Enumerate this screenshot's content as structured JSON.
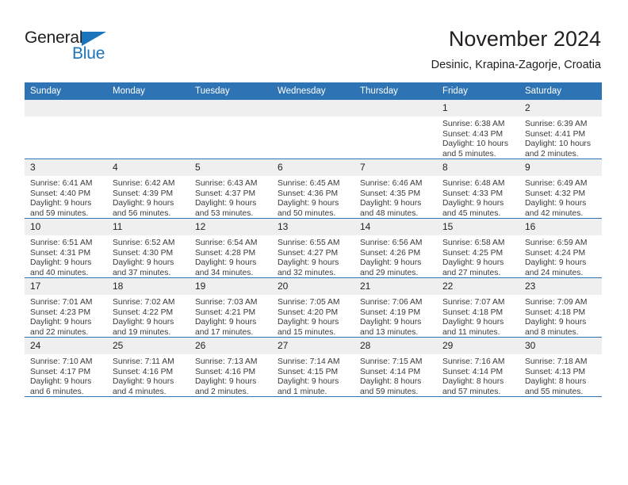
{
  "brand": {
    "name_part1": "General",
    "name_part2": "Blue",
    "triangle_color": "#1b75bc"
  },
  "header": {
    "title": "November 2024",
    "subtitle": "Desinic, Krapina-Zagorje, Croatia",
    "accent_color": "#2e74b5"
  },
  "weekday_headers": [
    "Sunday",
    "Monday",
    "Tuesday",
    "Wednesday",
    "Thursday",
    "Friday",
    "Saturday"
  ],
  "weeks": [
    [
      {
        "day": "",
        "blank": true,
        "sunrise": "",
        "sunset": "",
        "daylight1": "",
        "daylight2": ""
      },
      {
        "day": "",
        "blank": true,
        "sunrise": "",
        "sunset": "",
        "daylight1": "",
        "daylight2": ""
      },
      {
        "day": "",
        "blank": true,
        "sunrise": "",
        "sunset": "",
        "daylight1": "",
        "daylight2": ""
      },
      {
        "day": "",
        "blank": true,
        "sunrise": "",
        "sunset": "",
        "daylight1": "",
        "daylight2": ""
      },
      {
        "day": "",
        "blank": true,
        "sunrise": "",
        "sunset": "",
        "daylight1": "",
        "daylight2": ""
      },
      {
        "day": "1",
        "blank": false,
        "sunrise": "Sunrise: 6:38 AM",
        "sunset": "Sunset: 4:43 PM",
        "daylight1": "Daylight: 10 hours",
        "daylight2": "and 5 minutes."
      },
      {
        "day": "2",
        "blank": false,
        "sunrise": "Sunrise: 6:39 AM",
        "sunset": "Sunset: 4:41 PM",
        "daylight1": "Daylight: 10 hours",
        "daylight2": "and 2 minutes."
      }
    ],
    [
      {
        "day": "3",
        "blank": false,
        "sunrise": "Sunrise: 6:41 AM",
        "sunset": "Sunset: 4:40 PM",
        "daylight1": "Daylight: 9 hours",
        "daylight2": "and 59 minutes."
      },
      {
        "day": "4",
        "blank": false,
        "sunrise": "Sunrise: 6:42 AM",
        "sunset": "Sunset: 4:39 PM",
        "daylight1": "Daylight: 9 hours",
        "daylight2": "and 56 minutes."
      },
      {
        "day": "5",
        "blank": false,
        "sunrise": "Sunrise: 6:43 AM",
        "sunset": "Sunset: 4:37 PM",
        "daylight1": "Daylight: 9 hours",
        "daylight2": "and 53 minutes."
      },
      {
        "day": "6",
        "blank": false,
        "sunrise": "Sunrise: 6:45 AM",
        "sunset": "Sunset: 4:36 PM",
        "daylight1": "Daylight: 9 hours",
        "daylight2": "and 50 minutes."
      },
      {
        "day": "7",
        "blank": false,
        "sunrise": "Sunrise: 6:46 AM",
        "sunset": "Sunset: 4:35 PM",
        "daylight1": "Daylight: 9 hours",
        "daylight2": "and 48 minutes."
      },
      {
        "day": "8",
        "blank": false,
        "sunrise": "Sunrise: 6:48 AM",
        "sunset": "Sunset: 4:33 PM",
        "daylight1": "Daylight: 9 hours",
        "daylight2": "and 45 minutes."
      },
      {
        "day": "9",
        "blank": false,
        "sunrise": "Sunrise: 6:49 AM",
        "sunset": "Sunset: 4:32 PM",
        "daylight1": "Daylight: 9 hours",
        "daylight2": "and 42 minutes."
      }
    ],
    [
      {
        "day": "10",
        "blank": false,
        "sunrise": "Sunrise: 6:51 AM",
        "sunset": "Sunset: 4:31 PM",
        "daylight1": "Daylight: 9 hours",
        "daylight2": "and 40 minutes."
      },
      {
        "day": "11",
        "blank": false,
        "sunrise": "Sunrise: 6:52 AM",
        "sunset": "Sunset: 4:30 PM",
        "daylight1": "Daylight: 9 hours",
        "daylight2": "and 37 minutes."
      },
      {
        "day": "12",
        "blank": false,
        "sunrise": "Sunrise: 6:54 AM",
        "sunset": "Sunset: 4:28 PM",
        "daylight1": "Daylight: 9 hours",
        "daylight2": "and 34 minutes."
      },
      {
        "day": "13",
        "blank": false,
        "sunrise": "Sunrise: 6:55 AM",
        "sunset": "Sunset: 4:27 PM",
        "daylight1": "Daylight: 9 hours",
        "daylight2": "and 32 minutes."
      },
      {
        "day": "14",
        "blank": false,
        "sunrise": "Sunrise: 6:56 AM",
        "sunset": "Sunset: 4:26 PM",
        "daylight1": "Daylight: 9 hours",
        "daylight2": "and 29 minutes."
      },
      {
        "day": "15",
        "blank": false,
        "sunrise": "Sunrise: 6:58 AM",
        "sunset": "Sunset: 4:25 PM",
        "daylight1": "Daylight: 9 hours",
        "daylight2": "and 27 minutes."
      },
      {
        "day": "16",
        "blank": false,
        "sunrise": "Sunrise: 6:59 AM",
        "sunset": "Sunset: 4:24 PM",
        "daylight1": "Daylight: 9 hours",
        "daylight2": "and 24 minutes."
      }
    ],
    [
      {
        "day": "17",
        "blank": false,
        "sunrise": "Sunrise: 7:01 AM",
        "sunset": "Sunset: 4:23 PM",
        "daylight1": "Daylight: 9 hours",
        "daylight2": "and 22 minutes."
      },
      {
        "day": "18",
        "blank": false,
        "sunrise": "Sunrise: 7:02 AM",
        "sunset": "Sunset: 4:22 PM",
        "daylight1": "Daylight: 9 hours",
        "daylight2": "and 19 minutes."
      },
      {
        "day": "19",
        "blank": false,
        "sunrise": "Sunrise: 7:03 AM",
        "sunset": "Sunset: 4:21 PM",
        "daylight1": "Daylight: 9 hours",
        "daylight2": "and 17 minutes."
      },
      {
        "day": "20",
        "blank": false,
        "sunrise": "Sunrise: 7:05 AM",
        "sunset": "Sunset: 4:20 PM",
        "daylight1": "Daylight: 9 hours",
        "daylight2": "and 15 minutes."
      },
      {
        "day": "21",
        "blank": false,
        "sunrise": "Sunrise: 7:06 AM",
        "sunset": "Sunset: 4:19 PM",
        "daylight1": "Daylight: 9 hours",
        "daylight2": "and 13 minutes."
      },
      {
        "day": "22",
        "blank": false,
        "sunrise": "Sunrise: 7:07 AM",
        "sunset": "Sunset: 4:18 PM",
        "daylight1": "Daylight: 9 hours",
        "daylight2": "and 11 minutes."
      },
      {
        "day": "23",
        "blank": false,
        "sunrise": "Sunrise: 7:09 AM",
        "sunset": "Sunset: 4:18 PM",
        "daylight1": "Daylight: 9 hours",
        "daylight2": "and 8 minutes."
      }
    ],
    [
      {
        "day": "24",
        "blank": false,
        "sunrise": "Sunrise: 7:10 AM",
        "sunset": "Sunset: 4:17 PM",
        "daylight1": "Daylight: 9 hours",
        "daylight2": "and 6 minutes."
      },
      {
        "day": "25",
        "blank": false,
        "sunrise": "Sunrise: 7:11 AM",
        "sunset": "Sunset: 4:16 PM",
        "daylight1": "Daylight: 9 hours",
        "daylight2": "and 4 minutes."
      },
      {
        "day": "26",
        "blank": false,
        "sunrise": "Sunrise: 7:13 AM",
        "sunset": "Sunset: 4:16 PM",
        "daylight1": "Daylight: 9 hours",
        "daylight2": "and 2 minutes."
      },
      {
        "day": "27",
        "blank": false,
        "sunrise": "Sunrise: 7:14 AM",
        "sunset": "Sunset: 4:15 PM",
        "daylight1": "Daylight: 9 hours",
        "daylight2": "and 1 minute."
      },
      {
        "day": "28",
        "blank": false,
        "sunrise": "Sunrise: 7:15 AM",
        "sunset": "Sunset: 4:14 PM",
        "daylight1": "Daylight: 8 hours",
        "daylight2": "and 59 minutes."
      },
      {
        "day": "29",
        "blank": false,
        "sunrise": "Sunrise: 7:16 AM",
        "sunset": "Sunset: 4:14 PM",
        "daylight1": "Daylight: 8 hours",
        "daylight2": "and 57 minutes."
      },
      {
        "day": "30",
        "blank": false,
        "sunrise": "Sunrise: 7:18 AM",
        "sunset": "Sunset: 4:13 PM",
        "daylight1": "Daylight: 8 hours",
        "daylight2": "and 55 minutes."
      }
    ]
  ]
}
